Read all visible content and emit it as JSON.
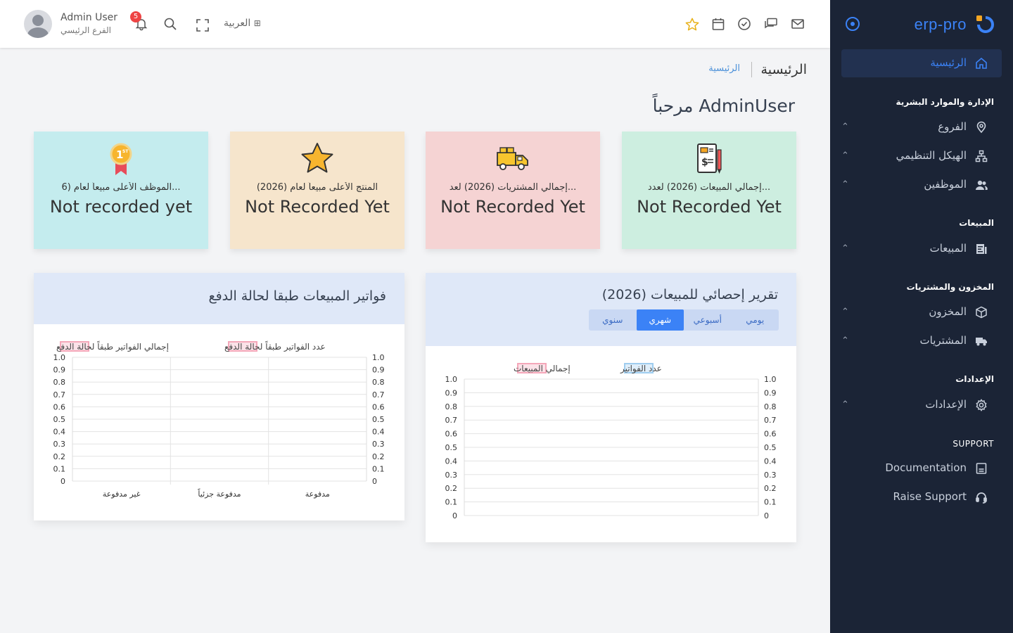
{
  "brand": {
    "name": "erp-pro",
    "accent": "#3b82f6"
  },
  "sidebar": {
    "home": "الرئيسية",
    "sections": [
      {
        "title": "الإدارة والموارد البشرية",
        "items": [
          "الفروع",
          "الهيكل التنظيمي",
          "الموظفين"
        ]
      },
      {
        "title": "المبيعات",
        "items": [
          "المبيعات"
        ]
      },
      {
        "title": "المخزون والمشتريات",
        "items": [
          "المخزون",
          "المشتريات"
        ]
      },
      {
        "title": "الإعدادات",
        "items": [
          "الإعدادات"
        ]
      },
      {
        "title": "SUPPORT",
        "items": [
          "Documentation",
          "Raise Support"
        ]
      }
    ]
  },
  "topbar": {
    "user_name": "Admin User",
    "user_branch": "الفرع الرئيسي",
    "notifications": "5",
    "language": "العربية"
  },
  "breadcrumb": {
    "title": "الرئيسية",
    "link": "الرئيسية"
  },
  "welcome": "مرحباً AdminUser",
  "cards": [
    {
      "title": "إجمالي المبيعات (2026) لعدد...",
      "value": "Not Recorded Yet",
      "bg": "#cdeee0",
      "icon": "invoice-icon"
    },
    {
      "title": "إجمالي المشتريات (2026) لعد...",
      "value": "Not Recorded Yet",
      "bg": "#f5d3d3",
      "icon": "truck-icon"
    },
    {
      "title": "المنتج الأعلى مبيعاً لعام (2026)",
      "value": "Not Recorded Yet",
      "bg": "#f6e5cc",
      "icon": "star-icon"
    },
    {
      "title": "الموظف الأعلى مبيعاً لعام (6...",
      "value": "Not recorded yet",
      "bg": "#c4ecee",
      "icon": "medal-icon"
    }
  ],
  "sales_report": {
    "title": "تقرير إحصائي للمبيعات (2026)",
    "tabs": [
      "يومي",
      "أسبوعي",
      "شهري",
      "سنوي"
    ],
    "active_tab": "شهري"
  },
  "invoices_report": {
    "title": "فواتير المبيعات طبقا لحالة الدفع"
  },
  "chart_data": [
    {
      "type": "line",
      "series": [
        {
          "name": "عدد الفواتير",
          "values": [],
          "color": "#9fcdef"
        },
        {
          "name": "إجمالي المبيعات",
          "values": [],
          "color": "#f4a7b9"
        }
      ],
      "ylim": [
        0,
        1
      ],
      "yticks": [
        "1.0",
        "0.9",
        "0.8",
        "0.7",
        "0.6",
        "0.5",
        "0.4",
        "0.3",
        "0.2",
        "0.1",
        "0"
      ],
      "legend": "top"
    },
    {
      "type": "bar",
      "categories": [
        "مدفوعة",
        "مدفوعة جزئياً",
        "غير مدفوعة"
      ],
      "series": [
        {
          "name": "عدد الفواتير طبقاً لحالة الدفع",
          "values": [],
          "color": "#f4a7b9"
        },
        {
          "name": "إجمالي الفواتير طبقاً لحالة الدفع",
          "values": [],
          "color": "#f4a7b9"
        }
      ],
      "ylim": [
        0,
        1
      ],
      "yticks": [
        "1.0",
        "0.9",
        "0.8",
        "0.7",
        "0.6",
        "0.5",
        "0.4",
        "0.3",
        "0.2",
        "0.1",
        "0"
      ],
      "legend": "top"
    }
  ]
}
